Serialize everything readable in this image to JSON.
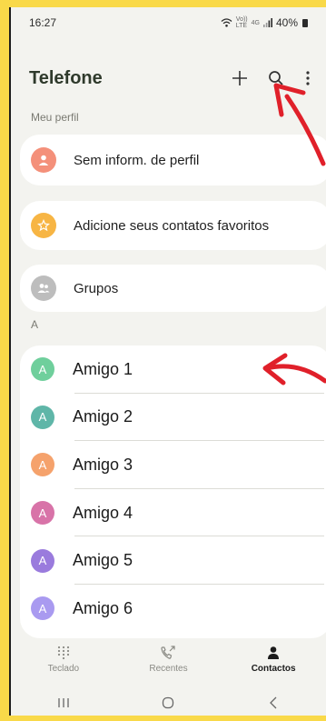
{
  "status_bar": {
    "time": "16:27",
    "network_top": "Vo))",
    "network_bottom": "LTE",
    "generation": "4G",
    "battery": "40%"
  },
  "header": {
    "title": "Telefone"
  },
  "profile_section": {
    "label": "Meu perfil",
    "profile_text": "Sem inform. de perfil"
  },
  "favorites": {
    "label": "Adicione seus contatos favoritos"
  },
  "groups": {
    "label": "Grupos"
  },
  "contacts_section": {
    "letter": "A",
    "contacts": [
      {
        "initial": "A",
        "name": "Amigo 1",
        "color": "#6fcf9c"
      },
      {
        "initial": "A",
        "name": "Amigo 2",
        "color": "#5fb6a8"
      },
      {
        "initial": "A",
        "name": "Amigo 3",
        "color": "#f5a26c"
      },
      {
        "initial": "A",
        "name": "Amigo 4",
        "color": "#d873a8"
      },
      {
        "initial": "A",
        "name": "Amigo 5",
        "color": "#9a7bdd"
      },
      {
        "initial": "A",
        "name": "Amigo 6",
        "color": "#a99af0"
      }
    ]
  },
  "bottom_nav": {
    "tabs": [
      {
        "label": "Teclado",
        "icon": "dialpad-icon"
      },
      {
        "label": "Recentes",
        "icon": "recent-calls-icon"
      },
      {
        "label": "Contactos",
        "icon": "person-icon"
      }
    ],
    "active": "Contactos"
  },
  "colors": {
    "background_border": "#f9d949",
    "annotation_arrow": "#e0202a",
    "profile_icon": "#f4907a",
    "favorites_icon": "#f7b544",
    "groups_icon": "#bdbdbd"
  }
}
